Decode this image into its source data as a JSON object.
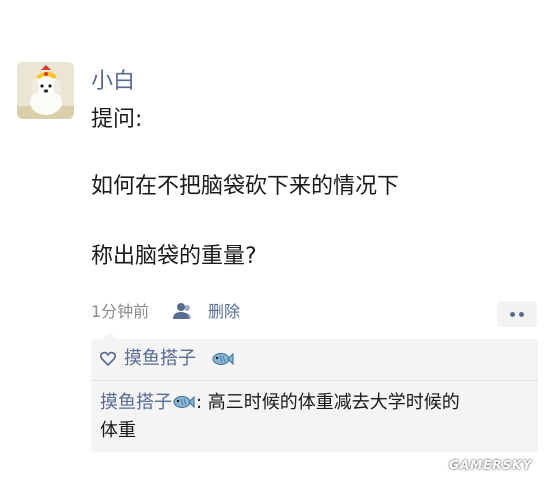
{
  "post": {
    "username": "小白",
    "lines": [
      "提问:",
      "如何在不把脑袋砍下来的情况下",
      "称出脑袋的重量?"
    ],
    "time": "1分钟前",
    "delete_label": "删除"
  },
  "likes": {
    "names": [
      "摸鱼搭子"
    ]
  },
  "comments": [
    {
      "author": "摸鱼搭子",
      "separator": ": ",
      "text_line1": "高三时候的体重减去大学时候的",
      "text_line2": "体重"
    }
  ],
  "watermark": "GAMERSKY",
  "colors": {
    "link": "#576b95",
    "text": "#1a1a1a",
    "meta": "#8c8c8c",
    "panel": "#f4f4f4"
  },
  "icons": {
    "avatar": "dog-avatar",
    "visibility": "user-icon",
    "more": "more-dots-icon",
    "like": "heart-icon",
    "emoji": "fish-emoji-icon"
  }
}
